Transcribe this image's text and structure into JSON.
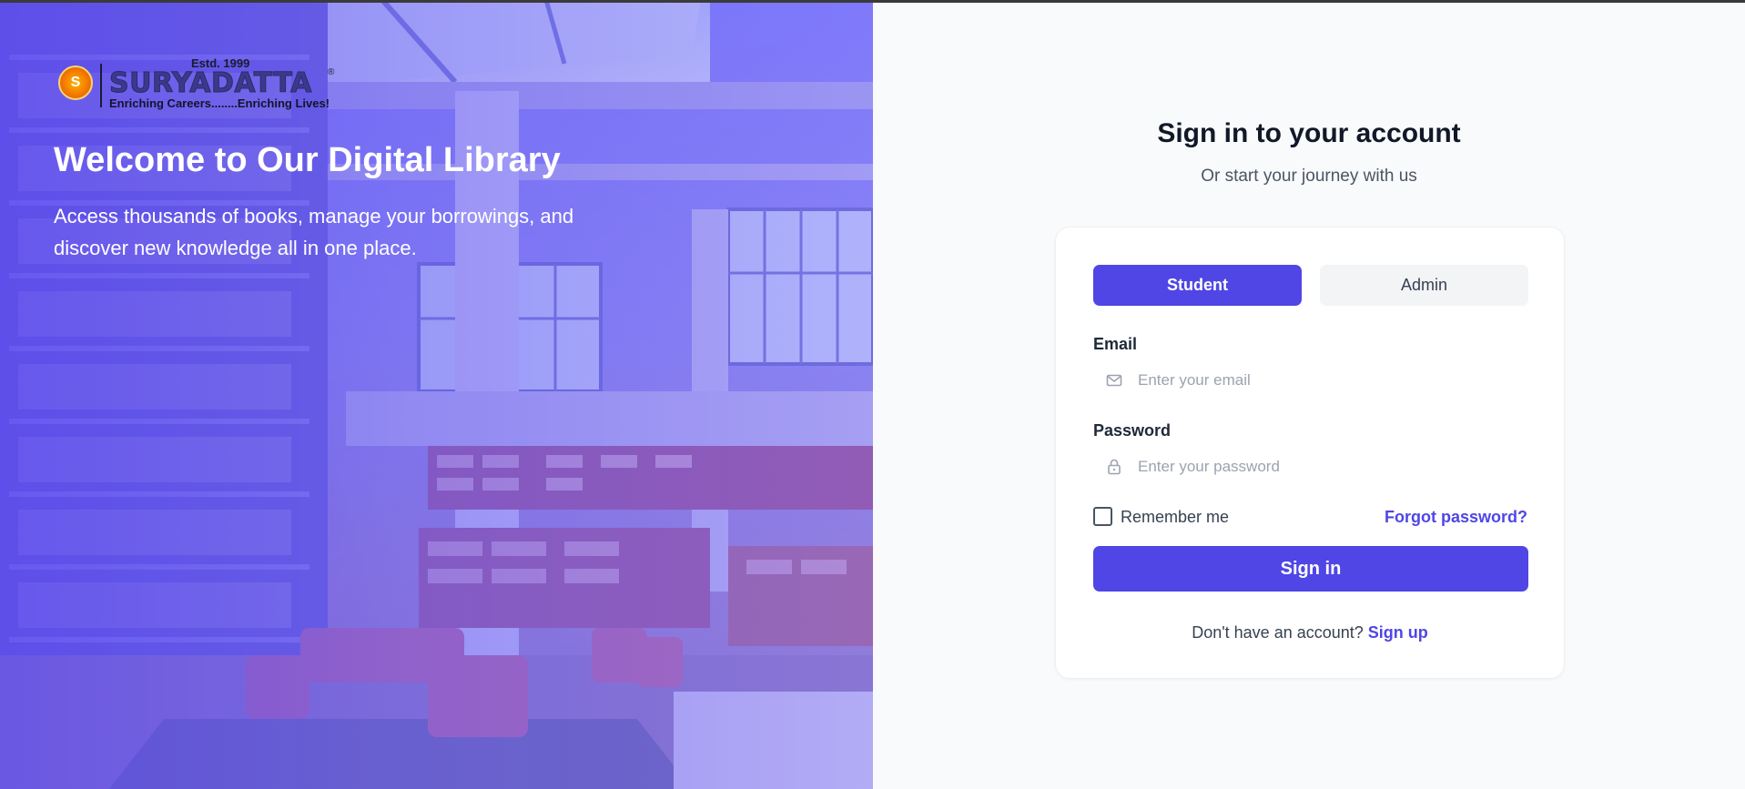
{
  "colors": {
    "accent": "#4f46e5",
    "hero_overlay": "#5b4ff0",
    "page_bg": "#f9fafb",
    "card_bg": "#ffffff",
    "heading": "#111827",
    "muted": "#4b5563"
  },
  "hero": {
    "logo": {
      "estd": "Estd. 1999",
      "brand": "SURYADATTA",
      "registered": "®",
      "tagline": "Enriching Careers........Enriching Lives!"
    },
    "title": "Welcome to Our Digital Library",
    "subtitle": "Access thousands of books, manage your borrowings, and discover new knowledge all in one place."
  },
  "auth": {
    "title": "Sign in to your account",
    "subtitle": "Or start your journey with us",
    "tabs": [
      {
        "label": "Student",
        "active": true
      },
      {
        "label": "Admin",
        "active": false
      }
    ],
    "email": {
      "label": "Email",
      "placeholder": "Enter your email",
      "value": "",
      "icon": "mail-icon"
    },
    "password": {
      "label": "Password",
      "placeholder": "Enter your password",
      "value": "",
      "icon": "lock-icon"
    },
    "remember_label": "Remember me",
    "remember_checked": false,
    "forgot_label": "Forgot password?",
    "submit_label": "Sign in",
    "signup_prompt": "Don't have an account?",
    "signup_link": "Sign up"
  }
}
